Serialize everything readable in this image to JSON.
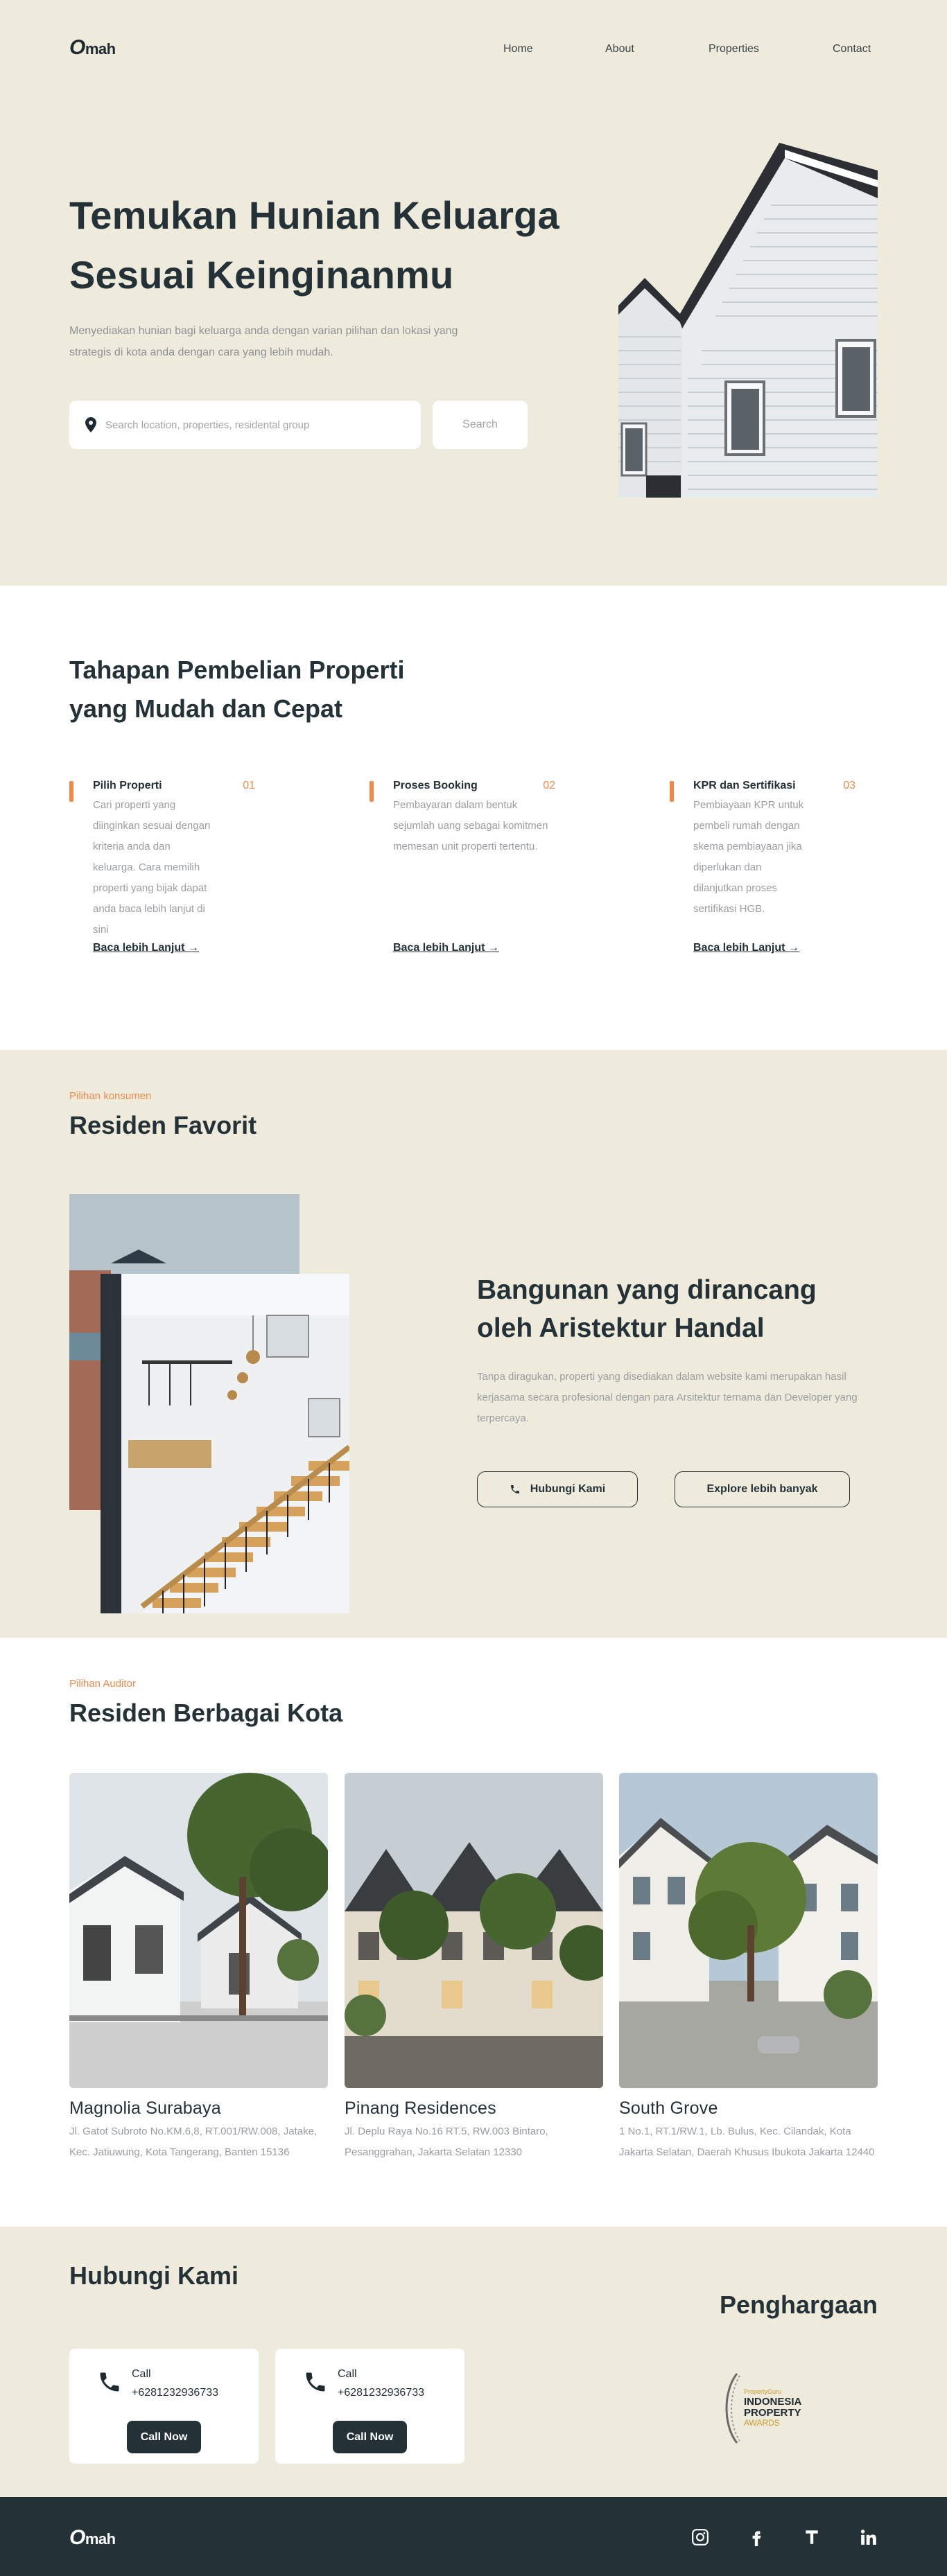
{
  "brand": {
    "logo_o": "O",
    "logo_rest": "mah"
  },
  "nav": {
    "items": [
      "Home",
      "About",
      "Properties",
      "Contact"
    ]
  },
  "hero": {
    "title_line1": "Temukan Hunian Keluarga",
    "title_line2": "Sesuai Keinginanmu",
    "subtitle": "Menyediakan hunian bagi keluarga anda dengan varian pilihan dan lokasi yang strategis di kota anda dengan cara yang lebih mudah.",
    "search_placeholder": "Search location, properties, residental group",
    "search_button": "Search"
  },
  "steps": {
    "title_line1": "Tahapan Pembelian Properti",
    "title_line2": "yang Mudah dan Cepat",
    "items": [
      {
        "title": "Pilih Properti",
        "num": "01",
        "desc": "Cari properti yang diinginkan sesuai dengan kriteria anda dan keluarga. Cara memilih properti yang bijak dapat anda baca lebih lanjut di sini",
        "link": "Baca lebih Lanjut →"
      },
      {
        "title": "Proses Booking",
        "num": "02",
        "desc": "Pembayaran dalam bentuk sejumlah uang sebagai komitmen memesan unit properti tertentu.",
        "link": "Baca lebih Lanjut →"
      },
      {
        "title": "KPR dan Sertifikasi",
        "num": "03",
        "desc": "Pembiayaan KPR untuk pembeli rumah dengan skema pembiayaan jika diperlukan dan dilanjutkan proses sertifikasi HGB.",
        "link": "Baca lebih Lanjut →"
      }
    ]
  },
  "favorit": {
    "eyebrow": "Pilihan konsumen",
    "title": "Residen Favorit",
    "heading_line1": "Bangunan yang dirancang",
    "heading_line2": "oleh Aristektur Handal",
    "text": "Tanpa diragukan, properti yang disediakan dalam website kami merupakan hasil kerjasama secara profesional dengan para Arsitektur ternama dan Developer yang terpercaya.",
    "btn_contact": "Hubungi Kami",
    "btn_explore": "Explore lebih banyak"
  },
  "cities": {
    "eyebrow": "Pilihan Auditor",
    "title": "Residen Berbagai Kota",
    "items": [
      {
        "name": "Magnolia Surabaya",
        "address": "Jl. Gatot Subroto No.KM.6,8, RT.001/RW.008, Jatake, Kec. Jatiuwung, Kota Tangerang, Banten 15136"
      },
      {
        "name": "Pinang Residences",
        "address": "Jl. Deplu Raya No.16 RT.5, RW.003 Bintaro, Pesanggrahan, Jakarta Selatan 12330"
      },
      {
        "name": "South Grove",
        "address": "1 No.1, RT.1/RW.1, Lb. Bulus, Kec. Cilandak, Kota Jakarta Selatan, Daerah Khusus Ibukota Jakarta 12440"
      }
    ]
  },
  "contact": {
    "title": "Hubungi Kami",
    "award_title": "Penghargaan",
    "cards": [
      {
        "label": "Call",
        "number": "+6281232936733",
        "button": "Call Now"
      },
      {
        "label": "Call",
        "number": "+6281232936733",
        "button": "Call Now"
      }
    ],
    "award": {
      "line1": "PropertyGuru",
      "line2": "INDONESIA",
      "line3": "PROPERTY",
      "line4": "AWARDS"
    }
  },
  "footer": {
    "social": [
      "instagram-icon",
      "facebook-icon",
      "tumblr-icon",
      "linkedin-icon"
    ]
  }
}
